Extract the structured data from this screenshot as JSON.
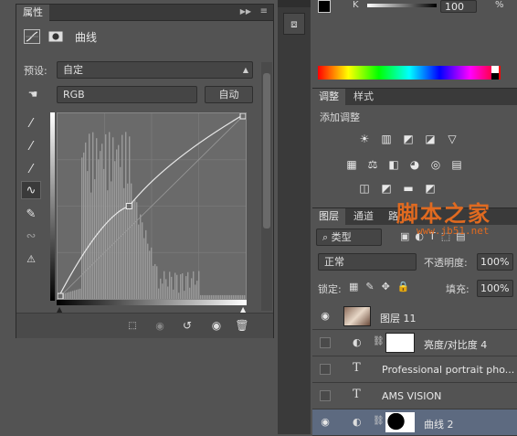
{
  "properties_panel": {
    "tab_label": "属性",
    "collapse_glyph": "▶▶",
    "menu_glyph": "≡",
    "mode_title": "曲线",
    "preset_label": "预设:",
    "preset_value": "自定",
    "channel_value": "RGB",
    "auto_button": "自动",
    "curve_points": [
      [
        0,
        0
      ],
      [
        0.38,
        0.5
      ],
      [
        1,
        1
      ]
    ],
    "footer_icons": [
      "clip-to-layer-icon",
      "view-previous-icon",
      "reset-icon",
      "visibility-icon",
      "delete-icon"
    ]
  },
  "color_panel": {
    "k_value": "100",
    "k_unit": "%",
    "k_label": "K"
  },
  "adjustments_panel": {
    "tabs": [
      "调整",
      "样式"
    ],
    "heading": "添加调整",
    "row1": [
      "☀",
      "▥",
      "◩",
      "◪",
      "▽"
    ],
    "row2": [
      "▦",
      "⚖",
      "◧",
      "◕",
      "◎",
      "▤"
    ],
    "row3": [
      "◫",
      "◩",
      "▬",
      "◩"
    ]
  },
  "layers_panel": {
    "tabs": [
      "图层",
      "通道",
      "路"
    ],
    "filter_kind": "类型",
    "blend_mode": "正常",
    "opacity_label": "不透明度:",
    "opacity_value": "100%",
    "lock_label": "锁定:",
    "fill_label": "填充:",
    "fill_value": "100%",
    "layers": [
      {
        "name": "图层 11",
        "visible": true,
        "type": "image"
      },
      {
        "name": "亮度/对比度 4",
        "visible": false,
        "type": "adjustment"
      },
      {
        "name": "Professional portrait pho...",
        "visible": false,
        "type": "text"
      },
      {
        "name": "AMS VISION",
        "visible": false,
        "type": "text"
      },
      {
        "name": "曲线 2",
        "visible": true,
        "type": "adjustment"
      }
    ]
  },
  "watermark": {
    "text": "脚本之家",
    "url": "www.jb51.net"
  }
}
